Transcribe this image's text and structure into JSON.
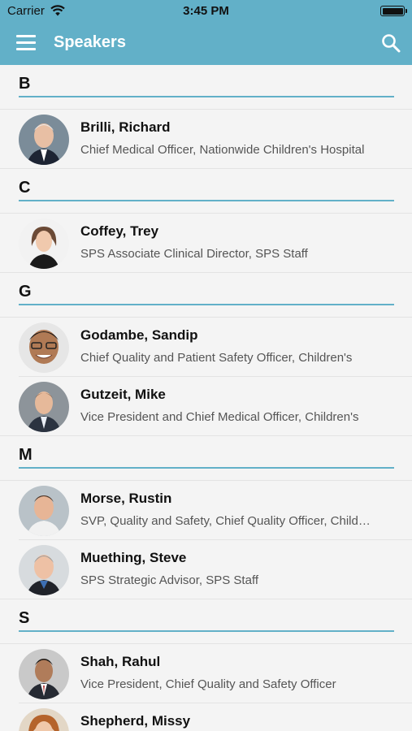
{
  "status_bar": {
    "carrier": "Carrier",
    "time": "3:45 PM",
    "battery_level": 1.0
  },
  "nav": {
    "title": "Speakers",
    "menu_icon": "hamburger-menu-icon",
    "search_icon": "search-icon"
  },
  "colors": {
    "accent": "#62b0c8",
    "background": "#f4f4f4"
  },
  "sections": [
    {
      "letter": "B",
      "speakers": [
        {
          "name": "Brilli, Richard",
          "subtitle": "Chief Medical Officer, Nationwide Children's Hospital"
        }
      ]
    },
    {
      "letter": "C",
      "speakers": [
        {
          "name": "Coffey, Trey",
          "subtitle": "SPS Associate Clinical Director, SPS Staff"
        }
      ]
    },
    {
      "letter": "G",
      "speakers": [
        {
          "name": "Godambe, Sandip",
          "subtitle": "Chief Quality and Patient Safety Officer, Children's"
        },
        {
          "name": "Gutzeit, Mike",
          "subtitle": "Vice President and Chief Medical Officer, Children's"
        }
      ]
    },
    {
      "letter": "M",
      "speakers": [
        {
          "name": "Morse, Rustin",
          "subtitle": "SVP, Quality and Safety, Chief Quality Officer, Children's"
        },
        {
          "name": "Muething, Steve",
          "subtitle": "SPS Strategic Advisor, SPS Staff"
        }
      ]
    },
    {
      "letter": "S",
      "speakers": [
        {
          "name": "Shah, Rahul",
          "subtitle": "Vice President, Chief Quality and Safety Officer"
        },
        {
          "name": "Shepherd, Missy",
          "subtitle": ""
        }
      ]
    }
  ]
}
